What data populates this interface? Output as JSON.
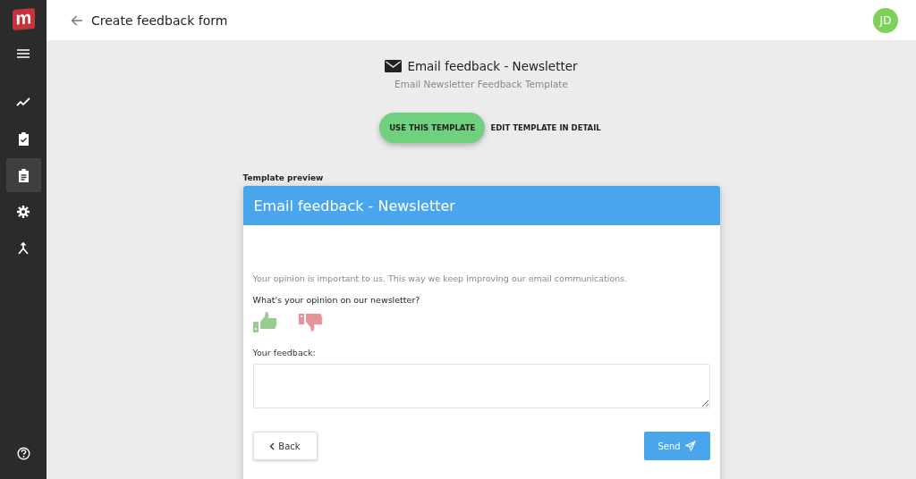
{
  "logo": {
    "text": "m"
  },
  "sidebar": {
    "items": [
      {
        "kind": "trend",
        "selected": false
      },
      {
        "kind": "task",
        "selected": false
      },
      {
        "kind": "clipboard",
        "selected": true
      },
      {
        "kind": "settings",
        "selected": false
      },
      {
        "kind": "merge",
        "selected": false
      }
    ]
  },
  "header": {
    "title": "Create feedback form",
    "avatar": "JD"
  },
  "template": {
    "title": "Email feedback - Newsletter",
    "subtitle": "Email Newsletter Feedback Template",
    "primary_action": "USE THIS TEMPLATE",
    "secondary_action": "EDIT TEMPLATE IN DETAIL"
  },
  "preview": {
    "label": "Template preview",
    "title": "Email feedback - Newsletter",
    "intro": "Your opinion is important to us. This way we keep improving our email communications.",
    "question": "What's your opinion on our newsletter?",
    "feedback_label": "Your feedback:",
    "back_button": "Back",
    "send_button": "Send"
  }
}
